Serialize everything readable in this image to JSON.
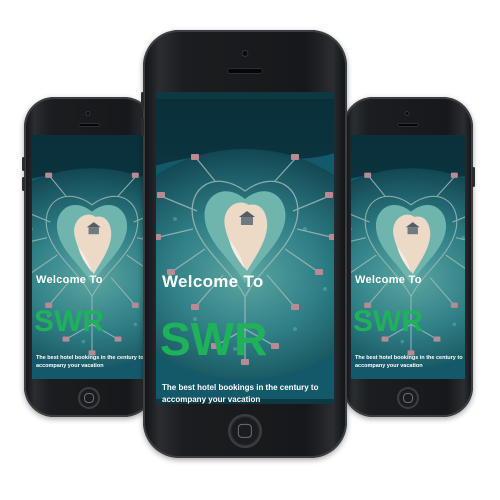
{
  "app": {
    "welcome_text": "Welcome To",
    "brand_name": "SWR",
    "tagline_line1": "The best hotel bookings in the century to",
    "tagline_line2": "accompany your vacation"
  },
  "colors": {
    "brand": "#1fb25a",
    "text": "#ffffff",
    "phone_body": "#16181b",
    "sea_deep": "#0b3a45",
    "sea_shallow": "#3f8f8c",
    "sand": "#ecd9c6"
  },
  "mockups": [
    {
      "id": "left-phone"
    },
    {
      "id": "center-phone"
    },
    {
      "id": "right-phone"
    }
  ]
}
